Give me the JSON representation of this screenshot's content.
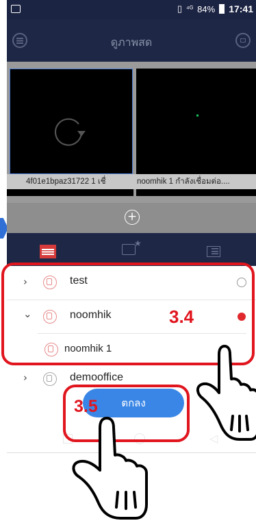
{
  "status_bar": {
    "signal": "⁴ᴳ",
    "battery": "84%",
    "time": "17:41"
  },
  "header": {
    "title": "ดูภาพสด"
  },
  "live_view": {
    "tile_labels": [
      "4f01e1bpaz31722 1  เชื่",
      "noomhik 1  กำลังเชื่อมต่อ...."
    ],
    "add_button": "+"
  },
  "tabs": [
    "device-list",
    "favorites",
    "multi-view"
  ],
  "devices": [
    {
      "name": "test",
      "expanded": false,
      "selected": false
    },
    {
      "name": "noomhik",
      "expanded": true,
      "selected": true,
      "cameras": [
        {
          "name": "noomhik 1"
        }
      ]
    },
    {
      "name": "demooffice",
      "expanded": false,
      "selected": false
    }
  ],
  "ok_button": "ตกลง",
  "annotations": {
    "step_a": "3.4",
    "step_b": "3.5"
  },
  "colors": {
    "header_bg": "#1e2846",
    "accent_blue": "#3a86e6",
    "annotation_red": "#e0151e",
    "selected_red": "#e0282d"
  }
}
